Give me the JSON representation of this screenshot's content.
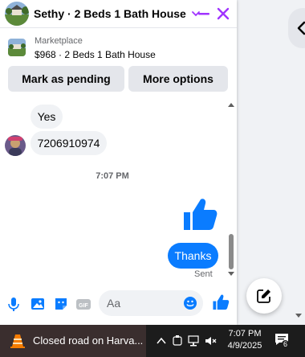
{
  "chat": {
    "contact_name": "Sethy · 2 Beds 1 Bath House",
    "marketplace_label": "Marketplace",
    "listing_title": "$968 · 2 Beds 1 Bath House",
    "actions": {
      "pending": "Mark as pending",
      "more": "More options"
    },
    "messages": [
      {
        "from": "them",
        "text": "Yes"
      },
      {
        "from": "them",
        "text": "7206910974"
      }
    ],
    "time_separator": "7:07 PM",
    "sent_text": "Thanks",
    "sent_status": "Sent",
    "input_placeholder": "Aa",
    "accent_color": "#0a7cff",
    "close_color": "#a033ff"
  },
  "icons": [
    "chevron-down-icon",
    "minimize-icon",
    "close-icon",
    "thumbs-up-icon",
    "microphone-icon",
    "photo-icon",
    "sticker-icon",
    "gif-icon",
    "emoji-icon",
    "compose-icon",
    "notification-icon"
  ],
  "taskbar": {
    "notice": "Closed road on Harva...",
    "time": "7:07 PM",
    "date": "4/9/2025",
    "notification_count": "6"
  }
}
